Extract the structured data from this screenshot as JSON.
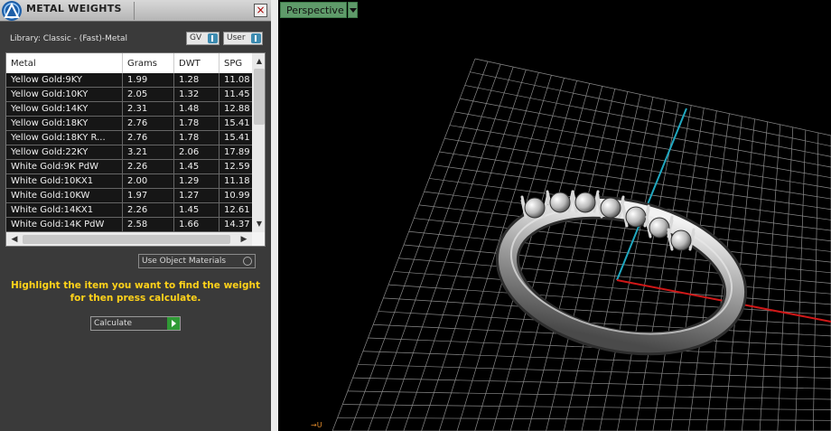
{
  "panel": {
    "title": "METAL WEIGHTS",
    "close_label": "×",
    "library_label": "Library: Classic - (Fast)-Metal",
    "selects": [
      {
        "label": "GV"
      },
      {
        "label": "User"
      }
    ],
    "table": {
      "columns": [
        "Metal",
        "Grams",
        "DWT",
        "SPG"
      ],
      "rows": [
        [
          "Yellow Gold:9KY",
          "1.99",
          "1.28",
          "11.08"
        ],
        [
          "Yellow Gold:10KY",
          "2.05",
          "1.32",
          "11.45"
        ],
        [
          "Yellow Gold:14KY",
          "2.31",
          "1.48",
          "12.88"
        ],
        [
          "Yellow Gold:18KY",
          "2.76",
          "1.78",
          "15.41"
        ],
        [
          "Yellow Gold:18KY R...",
          "2.76",
          "1.78",
          "15.41"
        ],
        [
          "Yellow Gold:22KY",
          "3.21",
          "2.06",
          "17.89"
        ],
        [
          "White Gold:9K PdW",
          "2.26",
          "1.45",
          "12.59"
        ],
        [
          "White Gold:10KX1",
          "2.00",
          "1.29",
          "11.18"
        ],
        [
          "White Gold:10KW",
          "1.97",
          "1.27",
          "10.99"
        ],
        [
          "White Gold:14KX1",
          "2.26",
          "1.45",
          "12.61"
        ],
        [
          "White Gold:14K PdW",
          "2.58",
          "1.66",
          "14.37"
        ]
      ]
    },
    "use_object_materials_label": "Use Object Materials",
    "hint": "Highlight the item you want to find the weight for then press calculate.",
    "calculate_label": "Calculate"
  },
  "viewport": {
    "view_label": "Perspective",
    "axis_indicator": "→U",
    "colors": {
      "x_axis": "#d01818",
      "y_axis": "#20a8c0",
      "grid": "#8a8a8a",
      "background": "#000000"
    }
  }
}
